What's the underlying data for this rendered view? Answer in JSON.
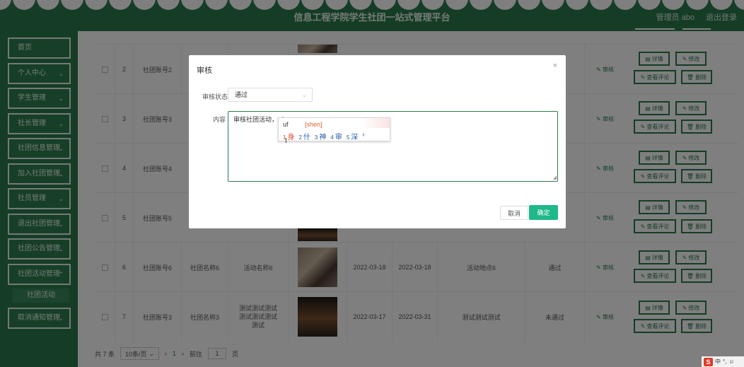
{
  "header": {
    "title": "信息工程学院学生社团一站式管理平台",
    "user": "管理员 abo",
    "logout": "退出登录",
    "color": "#2b7a4b"
  },
  "sidebar": {
    "items": [
      {
        "label": "首页",
        "chevron": false
      },
      {
        "label": "个人中心",
        "chevron": true
      },
      {
        "label": "学生管理",
        "chevron": true
      },
      {
        "label": "社长管理",
        "chevron": true
      },
      {
        "label": "社团信息管理",
        "chevron": true
      },
      {
        "label": "加入社团管理",
        "chevron": true
      },
      {
        "label": "社员管理",
        "chevron": true
      },
      {
        "label": "退出社团管理",
        "chevron": true
      },
      {
        "label": "社团公告管理",
        "chevron": true
      },
      {
        "label": "社团活动管理",
        "chevron": true
      }
    ],
    "sub_item": "社团活动",
    "last_item": "取消通知管理"
  },
  "table": {
    "rows": [
      {
        "index": "2",
        "account": "社团账号2",
        "club": "",
        "activity": "",
        "start": "",
        "end": "",
        "place": "",
        "status": "",
        "review": "审核"
      },
      {
        "index": "3",
        "account": "社团账号3",
        "club": "",
        "activity": "",
        "start": "",
        "end": "",
        "place": "",
        "status": "",
        "review": "审核"
      },
      {
        "index": "4",
        "account": "社团账号4",
        "club": "",
        "activity": "",
        "start": "",
        "end": "",
        "place": "",
        "status": "",
        "review": "审核"
      },
      {
        "index": "5",
        "account": "社团账号5",
        "club": "",
        "activity": "",
        "start": "",
        "end": "",
        "place": "",
        "status": "",
        "review": "审核"
      },
      {
        "index": "6",
        "account": "社团账号6",
        "club": "社团名称6",
        "activity": "活动名称6",
        "start": "2022-03-18",
        "end": "2022-03-18",
        "place": "活动地点6",
        "status": "通过",
        "review": "审核"
      },
      {
        "index": "7",
        "account": "社团账号3",
        "club": "社团名称3",
        "activity": "测试测试测试测试测试测试测试",
        "start": "2022-03-17",
        "end": "2022-03-31",
        "place": "测试测试测试",
        "status": "未通过",
        "review": "审核"
      }
    ],
    "actions": {
      "detail": "详情",
      "edit": "修改",
      "comments": "查看评论",
      "delete": "删除"
    }
  },
  "pager": {
    "total": "共 7 条",
    "page_size": "10条/页",
    "prev": "‹",
    "current": "1",
    "next": "›",
    "goto_label": "前往",
    "goto_value": "1",
    "page_suffix": "页"
  },
  "modal": {
    "title": "审核",
    "close": "×",
    "status_label": "审核状态",
    "status_value": "通过",
    "content_label": "内容",
    "content_value": "审核社团活动，uf",
    "cancel": "取消",
    "confirm": "确定",
    "confirm_color": "#1fb88a"
  },
  "ime": {
    "input": "uf",
    "pinyin": "[shen]",
    "candidates": [
      {
        "num": "1",
        "text": "身"
      },
      {
        "num": "2",
        "text": "什"
      },
      {
        "num": "3",
        "text": "神"
      },
      {
        "num": "4",
        "text": "审"
      },
      {
        "num": "5",
        "text": "深"
      }
    ],
    "more": "›"
  },
  "tray": {
    "logo": "S",
    "mode": "中"
  }
}
